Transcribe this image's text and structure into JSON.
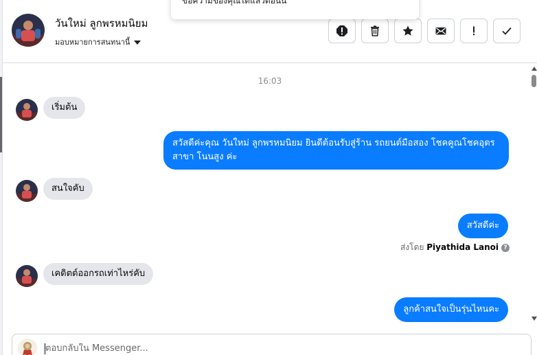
{
  "toast": {
    "text": "ข้อความของคุณได้แล้วตอนนี้"
  },
  "header": {
    "contact_name": "วันใหม่ ลูกพรหมนิยม",
    "assign_label": "มอบหมายการสนทนานี้",
    "toolbar_icons": [
      "alert-icon",
      "trash-icon",
      "star-icon",
      "mail-icon",
      "exclamation-icon",
      "check-icon"
    ]
  },
  "thread": {
    "timestamp": "16:03",
    "messages": [
      {
        "direction": "in",
        "text": "เริ่มต้น"
      },
      {
        "direction": "out",
        "line1": "สวัสดีค่ะคุณ วันใหม่ ลูกพรหมนิยม ยินดีต้อนรับสู่ร้าน รถยนต์มือสอง โชคคูณโชคอุดร",
        "line2": "สาขา โนนสูง ค่ะ"
      },
      {
        "direction": "in",
        "text": "สนใจคับ"
      },
      {
        "direction": "out",
        "text": "สวัสดีค่ะ"
      },
      {
        "direction": "in",
        "text": "เคดิตต์ออกรถเท่าไหร่คับ"
      },
      {
        "direction": "out",
        "text": "ลูกค้าสนใจเป็นรุ่นไหนคะ"
      }
    ],
    "sent_by_prefix": "ส่งโดย",
    "sent_by_name": "Piyathida Lanoi",
    "info_glyph": "?"
  },
  "composer": {
    "placeholder": "ตอบกลับใน Messenger..."
  },
  "colors": {
    "outgoing_bubble": "#0a7cff",
    "incoming_bubble": "#e4e6eb"
  }
}
